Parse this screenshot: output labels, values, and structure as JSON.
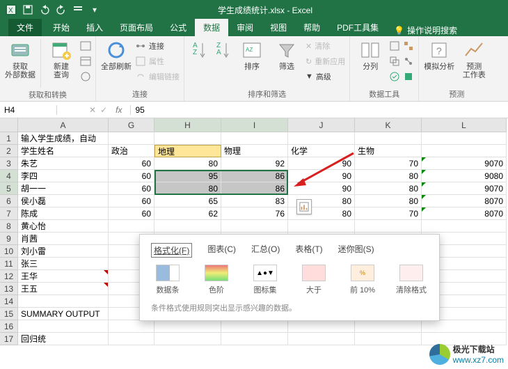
{
  "title": "学生成绩统计.xlsx  -  Excel",
  "qat": [
    "save",
    "undo",
    "redo",
    "touchmode",
    "dropdown"
  ],
  "tabs": {
    "file": "文件",
    "items": [
      "开始",
      "插入",
      "页面布局",
      "公式",
      "数据",
      "审阅",
      "视图",
      "帮助",
      "PDF工具集"
    ],
    "active": "数据",
    "tell_me": "操作说明搜索"
  },
  "ribbon": {
    "g1": {
      "btn1": "获取\n外部数据",
      "btn2": "新建\n查询",
      "label": "获取和转换"
    },
    "g2": {
      "btn": "全部刷新",
      "i1": "连接",
      "i2": "属性",
      "i3": "编辑链接",
      "label": "连接"
    },
    "g3": {
      "btn1": "排序",
      "btn2": "筛选",
      "i1": "清除",
      "i2": "重新应用",
      "i3": "高级",
      "label": "排序和筛选"
    },
    "g4": {
      "btn": "分列",
      "label": "数据工具"
    },
    "g5": {
      "btn1": "模拟分析",
      "btn2": "预测\n工作表",
      "label": "预测"
    }
  },
  "namebox": "H4",
  "fx": "fx",
  "formula": "95",
  "columns": [
    "A",
    "G",
    "H",
    "I",
    "J",
    "K",
    "L"
  ],
  "col_sel": [
    "H",
    "I"
  ],
  "rownums": [
    "1",
    "2",
    "3",
    "4",
    "5",
    "6",
    "7",
    "8",
    "9",
    "10",
    "11",
    "12",
    "13",
    "14",
    "15",
    "16",
    "17"
  ],
  "row_sel": [
    "4",
    "5"
  ],
  "cells": {
    "A": [
      "输入学生成绩，自动",
      "学生姓名",
      "朱艺",
      "李四",
      "胡一一",
      "侯小磊",
      "陈成",
      "黄心怡",
      "肖茜",
      "刘小雷",
      "张三",
      "王华",
      "王五",
      "",
      "SUMMARY OUTPUT",
      "",
      "回归统"
    ],
    "G": [
      "",
      "政治",
      "60",
      "60",
      "60",
      "60",
      "60",
      "",
      "",
      "",
      "",
      "",
      "",
      "",
      "",
      "",
      ""
    ],
    "H": [
      "",
      "地理",
      "80",
      "95",
      "80",
      "65",
      "62",
      "",
      "",
      "",
      "",
      "",
      "",
      "",
      "",
      "",
      ""
    ],
    "I": [
      "",
      "物理",
      "92",
      "86",
      "86",
      "83",
      "76",
      "",
      "",
      "",
      "",
      "",
      "",
      "",
      "",
      "",
      ""
    ],
    "J": [
      "",
      "化学",
      "90",
      "90",
      "90",
      "80",
      "80",
      "",
      "",
      "",
      "",
      "",
      "",
      "",
      "",
      "",
      ""
    ],
    "K": [
      "",
      "生物",
      "70",
      "80",
      "80",
      "80",
      "70",
      "",
      "",
      "",
      "",
      "",
      "",
      "",
      "",
      "",
      ""
    ],
    "L": [
      "",
      "",
      "9070",
      "9080",
      "9070",
      "8070",
      "8070",
      "",
      "",
      "",
      "",
      "",
      "",
      "",
      "",
      "",
      ""
    ]
  },
  "popup": {
    "tabs": [
      "格式化(F)",
      "图表(C)",
      "汇总(O)",
      "表格(T)",
      "迷你图(S)"
    ],
    "active": "格式化(F)",
    "options": [
      "数据条",
      "色阶",
      "图标集",
      "大于",
      "前 10%",
      "清除格式"
    ],
    "desc": "条件格式使用规则突出显示感兴趣的数据。"
  },
  "watermark": {
    "t1": "极光下载站",
    "t2": "www.xz7.com"
  },
  "chart_data": {
    "type": "table",
    "title": "学生成绩统计",
    "columns": [
      "学生姓名",
      "政治",
      "地理",
      "物理",
      "化学",
      "生物",
      "L"
    ],
    "rows": [
      [
        "朱艺",
        60,
        80,
        92,
        90,
        70,
        9070
      ],
      [
        "李四",
        60,
        95,
        86,
        90,
        80,
        9080
      ],
      [
        "胡一一",
        60,
        80,
        86,
        90,
        80,
        9070
      ],
      [
        "侯小磊",
        60,
        65,
        83,
        80,
        80,
        8070
      ],
      [
        "陈成",
        60,
        62,
        76,
        80,
        70,
        8070
      ]
    ],
    "selection": {
      "range": "H4:I5",
      "values": [
        [
          95,
          86
        ],
        [
          80,
          86
        ]
      ]
    }
  }
}
